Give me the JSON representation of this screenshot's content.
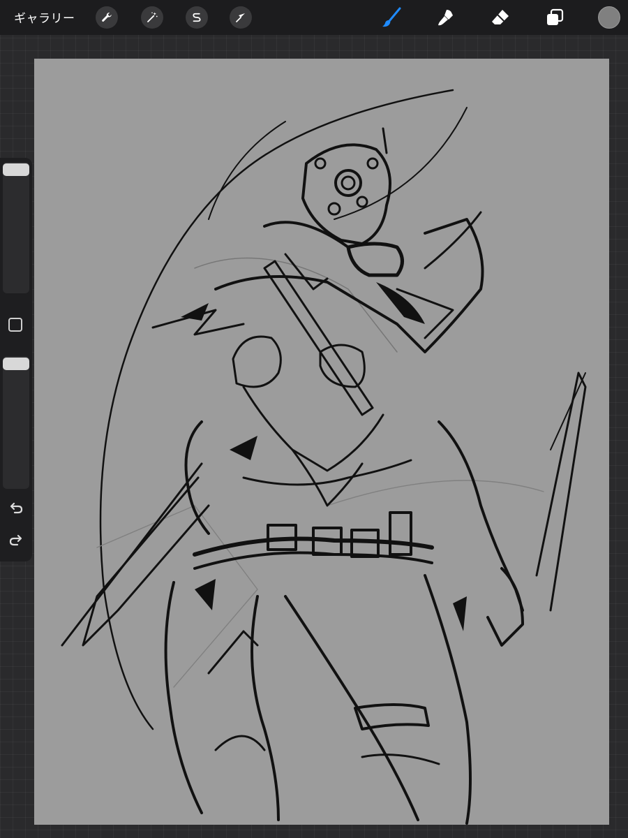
{
  "topbar": {
    "gallery_label": "ギャラリー",
    "left_tools": [
      {
        "icon": "wrench-icon",
        "name": "actions"
      },
      {
        "icon": "magic-wand-icon",
        "name": "adjustments"
      },
      {
        "icon": "selection-s-icon",
        "name": "selection"
      },
      {
        "icon": "arrow-cursor-icon",
        "name": "transform"
      }
    ],
    "right_tools": [
      {
        "icon": "brush-icon",
        "name": "paint",
        "active": true,
        "color": "#1f8bff"
      },
      {
        "icon": "smudge-icon",
        "name": "smudge",
        "active": false
      },
      {
        "icon": "eraser-icon",
        "name": "eraser",
        "active": false
      },
      {
        "icon": "layers-icon",
        "name": "layers",
        "active": false
      }
    ],
    "current_color": "#808080"
  },
  "sidebar": {
    "brush_size_level": 0.04,
    "opacity_level": 0.04,
    "modify_icon": "square-modify-icon",
    "undo_icon": "undo-icon",
    "redo_icon": "redo-icon"
  },
  "canvas": {
    "background_color": "#9c9c9c",
    "artwork": "ink-sketch-armored-character"
  }
}
